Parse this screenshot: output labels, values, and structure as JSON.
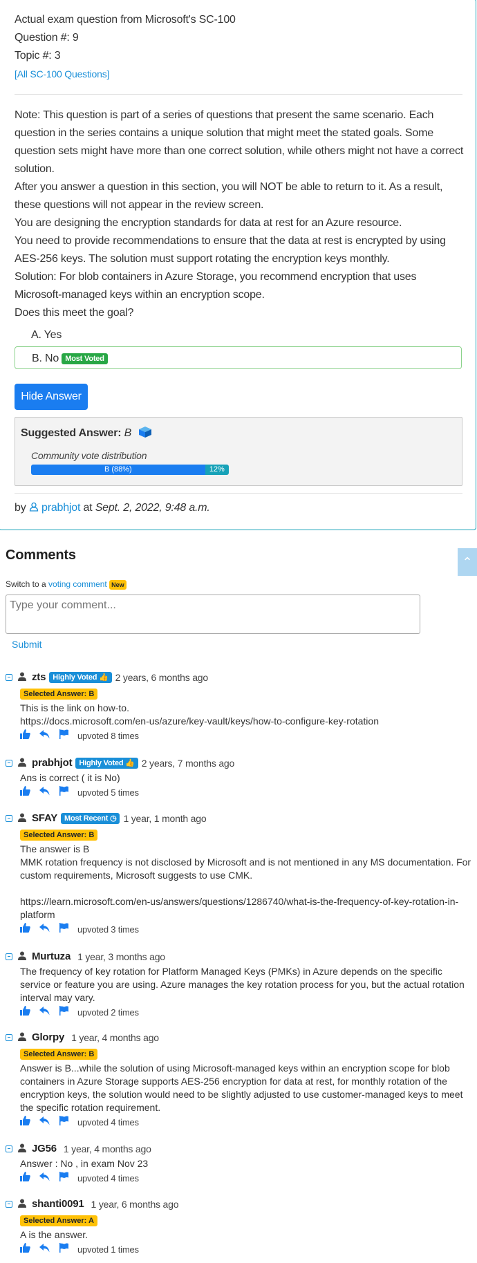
{
  "question": {
    "line1": "Actual exam question from Microsoft's SC-100",
    "line2": "Question #: 9",
    "line3": "Topic #: 3",
    "all_link": "[All SC-100 Questions]",
    "paragraphs": [
      "Note: This question is part of a series of questions that present the same scenario. Each question in the series contains a unique solution that might meet the stated goals. Some question sets might have more than one correct solution, while others might not have a correct solution.",
      "After you answer a question in this section, you will NOT be able to return to it. As a result, these questions will not appear in the review screen.",
      "You are designing the encryption standards for data at rest for an Azure resource.",
      "You need to provide recommendations to ensure that the data at rest is encrypted by using AES-256 keys. The solution must support rotating the encryption keys monthly.",
      "Solution: For blob containers in Azure Storage, you recommend encryption that uses Microsoft-managed keys within an encryption scope.",
      "Does this meet the goal?"
    ],
    "choices": [
      {
        "label": "A.  Yes",
        "badge": ""
      },
      {
        "label": "B.  No",
        "badge": "Most Voted"
      }
    ],
    "hide_button": "Hide Answer",
    "suggested_label": "Suggested Answer:",
    "suggested_value": "B",
    "vote_label": "Community vote distribution",
    "vote": [
      {
        "label": "B (88%)",
        "pct": 88
      },
      {
        "label": "12%",
        "pct": 12
      }
    ],
    "by": "by",
    "author": "prabhjot",
    "at": "at",
    "date": "Sept. 2, 2022, 9:48 a.m."
  },
  "comments_section": {
    "title": "Comments",
    "switch_text": "Switch to a",
    "switch_link": "voting comment",
    "new_badge": "New",
    "placeholder": "Type your comment...",
    "submit": "Submit"
  },
  "comments": [
    {
      "user": "zts",
      "badge": "Highly Voted",
      "time": "2 years, 6 months ago",
      "selected": "Selected Answer: B",
      "body": [
        "This is the link on how-to.",
        "https://docs.microsoft.com/en-us/azure/key-vault/keys/how-to-configure-key-rotation"
      ],
      "votes": "upvoted 8 times"
    },
    {
      "user": "prabhjot",
      "badge": "Highly Voted",
      "time": "2 years, 7 months ago",
      "selected": "",
      "body": [
        "Ans is correct ( it is No)"
      ],
      "votes": "upvoted 5 times"
    },
    {
      "user": "SFAY",
      "badge": "Most Recent",
      "time": "1 year, 1 month ago",
      "selected": "Selected Answer: B",
      "body": [
        "The answer is B",
        "MMK rotation frequency is not disclosed by Microsoft and is not mentioned in any MS documentation. For custom requirements, Microsoft suggests to use CMK.",
        "",
        "https://learn.microsoft.com/en-us/answers/questions/1286740/what-is-the-frequency-of-key-rotation-in-platform"
      ],
      "votes": "upvoted 3 times"
    },
    {
      "user": "Murtuza",
      "badge": "",
      "time": "1 year, 3 months ago",
      "selected": "",
      "body": [
        "The frequency of key rotation for Platform Managed Keys (PMKs) in Azure depends on the specific service or feature you are using. Azure manages the key rotation process for you, but the actual rotation interval may vary."
      ],
      "votes": "upvoted 2 times"
    },
    {
      "user": "Glorpy",
      "badge": "",
      "time": "1 year, 4 months ago",
      "selected": "Selected Answer: B",
      "body": [
        "Answer is B...while the solution of using Microsoft-managed keys within an encryption scope for blob containers in Azure Storage supports AES-256 encryption for data at rest, for monthly rotation of the encryption keys, the solution would need to be slightly adjusted to use customer-managed keys to meet the specific rotation requirement."
      ],
      "votes": "upvoted 4 times"
    },
    {
      "user": "JG56",
      "badge": "",
      "time": "1 year, 4 months ago",
      "selected": "",
      "body": [
        "Answer : No , in exam Nov 23"
      ],
      "votes": "upvoted 4 times"
    },
    {
      "user": "shanti0091",
      "badge": "",
      "time": "1 year, 6 months ago",
      "selected": "Selected Answer: A",
      "body": [
        "A is the answer."
      ],
      "votes": "upvoted 1 times"
    }
  ]
}
